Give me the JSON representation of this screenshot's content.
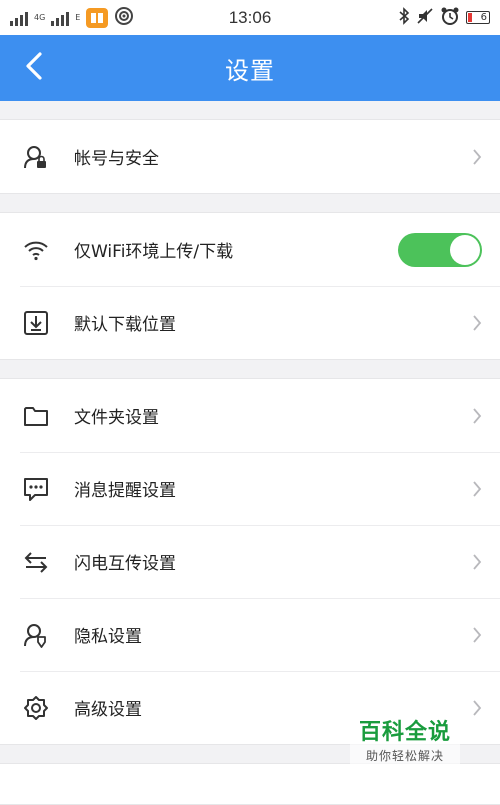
{
  "status_bar": {
    "network_label": "4G",
    "network_sublabel": "E",
    "time": "13:06",
    "battery_level": "6",
    "icons": [
      "signal-icon",
      "signal-icon",
      "app-icon",
      "wifi-hotspot-icon",
      "bluetooth-icon",
      "mute-icon",
      "alarm-icon",
      "battery-icon"
    ]
  },
  "header": {
    "title": "设置",
    "back_icon": "chevron-left-icon"
  },
  "groups": [
    {
      "items": [
        {
          "label": "帐号与安全",
          "icon": "account-security-icon",
          "control": "chevron"
        }
      ]
    },
    {
      "items": [
        {
          "label": "仅WiFi环境上传/下载",
          "icon": "wifi-icon",
          "control": "toggle",
          "toggle_on": true
        },
        {
          "label": "默认下载位置",
          "icon": "download-location-icon",
          "control": "chevron"
        }
      ]
    },
    {
      "items": [
        {
          "label": "文件夹设置",
          "icon": "folder-icon",
          "control": "chevron"
        },
        {
          "label": "消息提醒设置",
          "icon": "message-icon",
          "control": "chevron"
        },
        {
          "label": "闪电互传设置",
          "icon": "transfer-icon",
          "control": "chevron"
        },
        {
          "label": "隐私设置",
          "icon": "privacy-icon",
          "control": "chevron"
        },
        {
          "label": "高级设置",
          "icon": "gear-icon",
          "control": "chevron"
        }
      ]
    }
  ],
  "watermark": {
    "title": "百科全说",
    "subtitle": "助你轻松解决"
  },
  "colors": {
    "header": "#3d8ff0",
    "toggle_on": "#4cc25a",
    "watermark": "#1a9c3e"
  }
}
